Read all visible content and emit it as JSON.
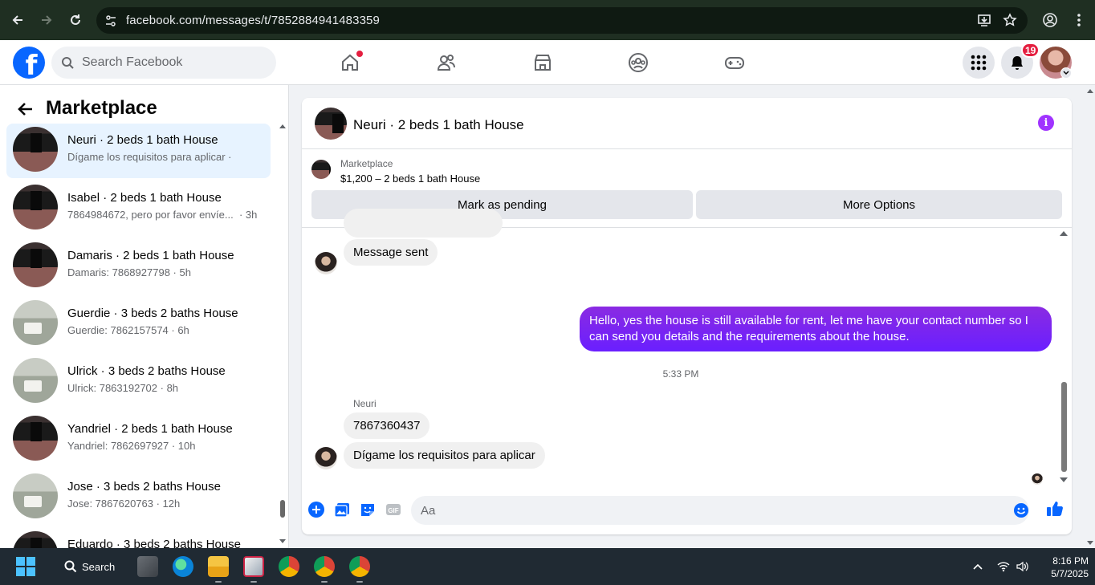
{
  "browser": {
    "url": "facebook.com/messages/t/7852884941483359",
    "icons": [
      "back-arrow-icon",
      "forward-arrow-icon",
      "reload-icon",
      "site-settings-icon",
      "install-app-icon",
      "bookmark-star-icon",
      "profile-icon",
      "kebab-menu-icon"
    ]
  },
  "header": {
    "logo": "f",
    "search_placeholder": "Search Facebook",
    "notifications_count": "19",
    "colors": {
      "brand": "#0866ff",
      "badge": "#e41e3f"
    },
    "nav_icons": [
      "home-icon",
      "friends-icon",
      "marketplace-icon",
      "groups-icon",
      "gaming-icon"
    ]
  },
  "sidebar": {
    "title": "Marketplace",
    "conversations": [
      {
        "name": "Neuri · 2 beds 1 bath House",
        "snippet": "Dígame los requisitos para aplicar ·",
        "thumb": "dark",
        "active": true
      },
      {
        "name": "Isabel · 2 beds 1 bath House",
        "snippet": "7864984672, pero por favor envíe...",
        "time": "· 3h",
        "thumb": "dark"
      },
      {
        "name": "Damaris · 2 beds 1 bath House",
        "snippet": "Damaris: 7868927798 · 5h",
        "thumb": "dark"
      },
      {
        "name": "Guerdie · 3 beds 2 baths House",
        "snippet": "Guerdie: 7862157574 · 6h",
        "thumb": "light"
      },
      {
        "name": "Ulrick · 3 beds 2 baths House",
        "snippet": "Ulrick: 7863192702 · 8h",
        "thumb": "light"
      },
      {
        "name": "Yandriel · 2 beds 1 bath House",
        "snippet": "Yandriel: 7862697927 · 10h",
        "thumb": "dark"
      },
      {
        "name": "Jose · 3 beds 2 baths House",
        "snippet": "Jose: 7867620763 · 12h",
        "thumb": "light"
      },
      {
        "name": "Eduardo · 3 beds 2 baths House",
        "snippet": "",
        "thumb": "dark"
      }
    ]
  },
  "chat": {
    "title": "Neuri · 2 beds 1 bath House",
    "marketplace_label": "Marketplace",
    "listing": "$1,200 – 2 beds 1 bath House",
    "mark_pending": "Mark as pending",
    "more_options": "More Options",
    "messages": {
      "sent_notice": "Message sent",
      "outgoing": "Hello, yes the house is still available for rent, let me have your contact number so I can send you details and the requirements about the house.",
      "timestamp": "5:33 PM",
      "sender": "Neuri",
      "incoming_1": "7867360437",
      "incoming_2": "Dígame los requisitos para aplicar"
    },
    "composer_placeholder": "Aa",
    "colors": {
      "outgoing_bubble": "#7a1fff",
      "accent": "#0866ff",
      "info": "#a033ff"
    }
  },
  "taskbar": {
    "search_label": "Search",
    "time": "8:16 PM",
    "date": "5/7/2025"
  }
}
